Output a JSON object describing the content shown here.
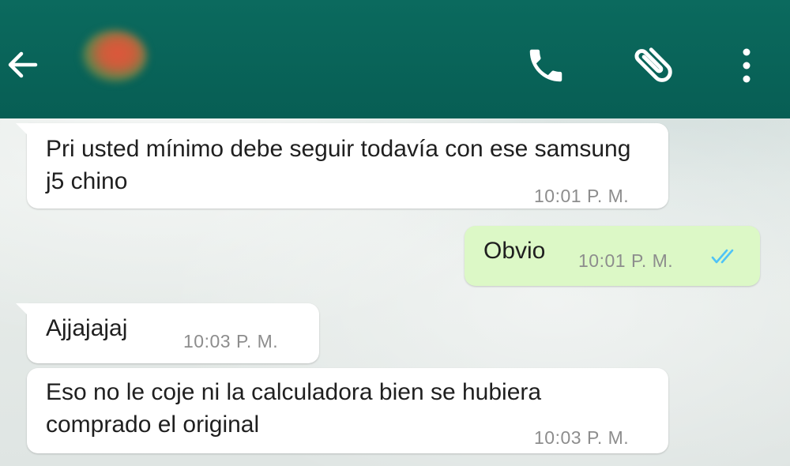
{
  "header": {
    "back_icon": "arrow-left-icon",
    "call_icon": "phone-icon",
    "attach_icon": "paperclip-icon",
    "menu_icon": "more-vertical-icon",
    "background_color": "#075e54"
  },
  "messages": [
    {
      "direction": "incoming",
      "text": "Pri usted mínimo debe seguir todavía con ese samsung j5 chino",
      "time": "10:01 P. M."
    },
    {
      "direction": "outgoing",
      "text": "Obvio",
      "time": "10:01 P. M.",
      "status_icon": "double-check-read-icon",
      "status_color": "#4fc3f7"
    },
    {
      "direction": "incoming",
      "text": "Ajjajajaj",
      "time": "10:03 P. M."
    },
    {
      "direction": "incoming",
      "text": "Eso no le coje ni la calculadora bien se hubiera comprado el original",
      "time": "10:03 P. M."
    }
  ],
  "colors": {
    "incoming_bubble": "#ffffff",
    "outgoing_bubble": "#dcf8c6",
    "timestamp": "#8d8d8d"
  }
}
